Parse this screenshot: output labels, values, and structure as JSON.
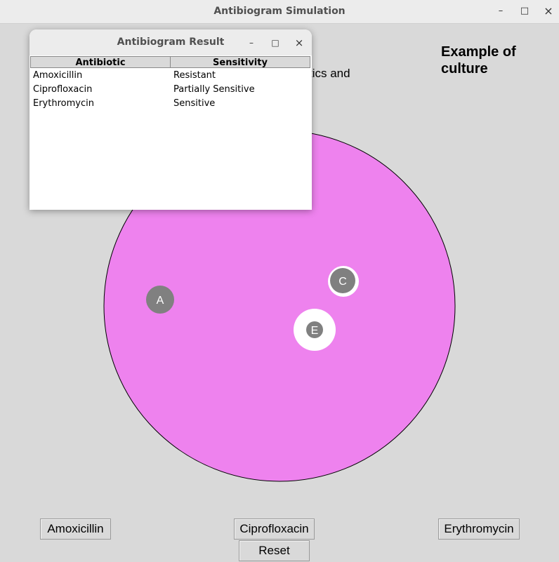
{
  "window": {
    "title": "Antibiogram Simulation",
    "minimize": "–",
    "maximize": "□",
    "close": "×"
  },
  "main": {
    "heading": "Example of culture",
    "partial_text": "tics and"
  },
  "dish": {
    "fill_color": "#ee82ee",
    "disks": [
      {
        "label": "A",
        "zone": "none"
      },
      {
        "label": "C",
        "zone": "small"
      },
      {
        "label": "E",
        "zone": "large"
      }
    ]
  },
  "buttons": {
    "amoxicillin": "Amoxicillin",
    "ciprofloxacin": "Ciprofloxacin",
    "erythromycin": "Erythromycin",
    "reset": "Reset"
  },
  "popup": {
    "title": "Antibiogram Result",
    "minimize": "–",
    "maximize": "□",
    "close": "×",
    "columns": [
      "Antibiotic",
      "Sensitivity"
    ],
    "rows": [
      {
        "antibiotic": "Amoxicillin",
        "sensitivity": "Resistant"
      },
      {
        "antibiotic": "Ciprofloxacin",
        "sensitivity": "Partially Sensitive"
      },
      {
        "antibiotic": "Erythromycin",
        "sensitivity": "Sensitive"
      }
    ]
  }
}
